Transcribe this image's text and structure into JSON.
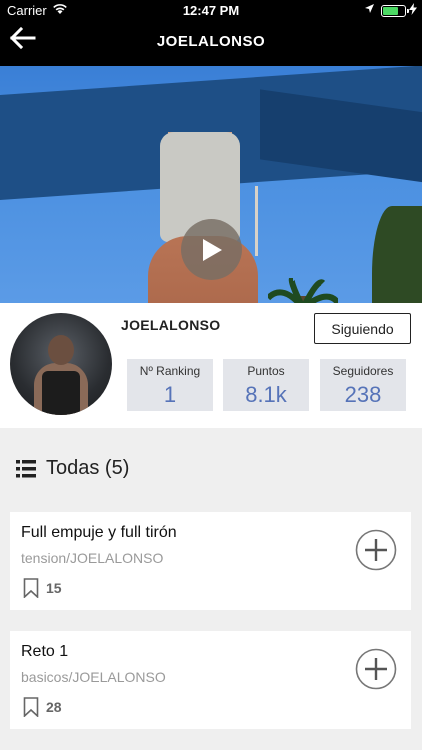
{
  "status_bar": {
    "carrier": "Carrier",
    "time": "12:47 PM",
    "battery_level": 0.75
  },
  "nav": {
    "title": "JOELALONSO",
    "back_icon": "arrow-left-icon"
  },
  "video": {
    "play_icon": "play-icon"
  },
  "profile": {
    "username": "JOELALONSO",
    "follow_label": "Siguiendo",
    "stats": [
      {
        "label": "Nº Ranking",
        "value": "1"
      },
      {
        "label": "Puntos",
        "value": "8.1k"
      },
      {
        "label": "Seguidores",
        "value": "238"
      }
    ]
  },
  "section": {
    "icon": "list-icon",
    "title": "Todas (5)"
  },
  "routines": [
    {
      "title": "Full empuje y full tirón",
      "subtitle": "tension/JOELALONSO",
      "saves": "15"
    },
    {
      "title": "Reto 1",
      "subtitle": "basicos/JOELALONSO",
      "saves": "28"
    }
  ],
  "colors": {
    "nav_bg": "#000000",
    "stat_value": "#5673b8",
    "stat_bg": "#e3e5ea",
    "page_bg": "#efefef",
    "battery": "#4cd964"
  }
}
